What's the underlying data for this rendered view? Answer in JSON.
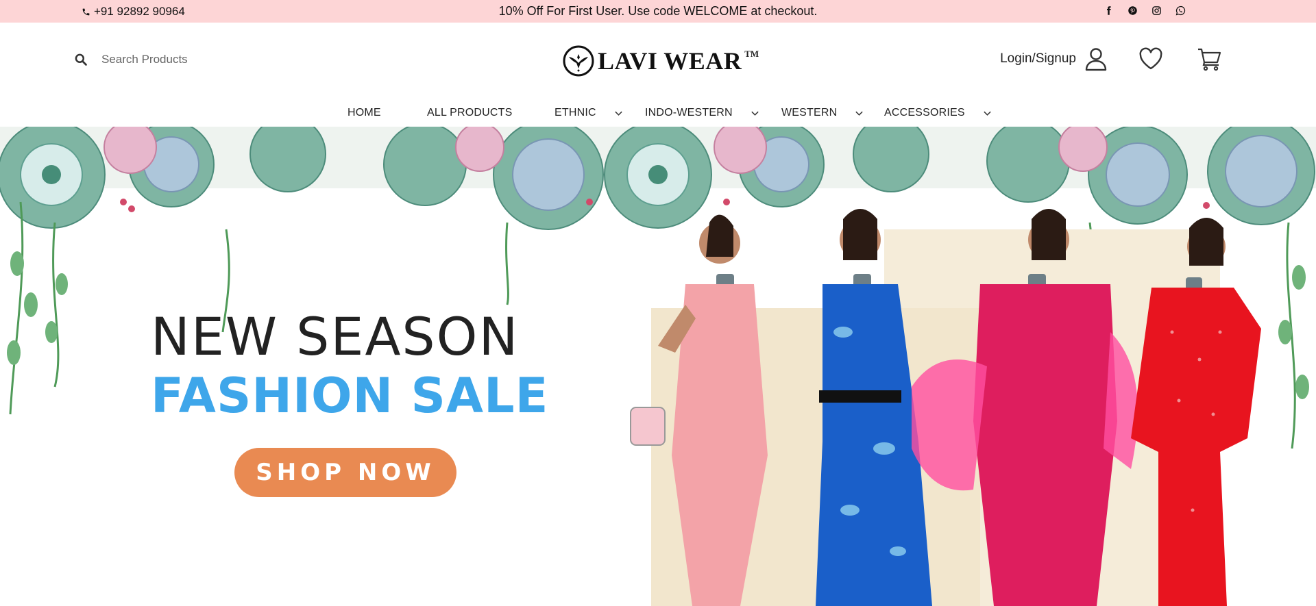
{
  "topbar": {
    "phone": "+91 92892 90964",
    "promo": "10% Off For First User. Use code WELCOME at checkout.",
    "socials": [
      "facebook-icon",
      "pinterest-icon",
      "instagram-icon",
      "whatsapp-icon"
    ]
  },
  "header": {
    "search_placeholder": "Search Products",
    "logo_text": "LAVI WEAR",
    "logo_tm": "TM",
    "login_label": "Login/Signup"
  },
  "nav": {
    "items": [
      {
        "label": "HOME",
        "dropdown": false
      },
      {
        "label": "ALL PRODUCTS",
        "dropdown": false
      },
      {
        "label": "ETHNIC",
        "dropdown": true
      },
      {
        "label": "INDO-WESTERN",
        "dropdown": true
      },
      {
        "label": "WESTERN",
        "dropdown": true
      },
      {
        "label": "ACCESSORIES",
        "dropdown": true
      }
    ]
  },
  "hero": {
    "headline": "NEW SEASON",
    "subheadline": "FASHION SALE",
    "cta_label": "SHOP NOW"
  },
  "colors": {
    "topbar_bg": "#fdd5d6",
    "accent_blue": "#3ea6ea",
    "cta_orange": "#e98a52"
  }
}
